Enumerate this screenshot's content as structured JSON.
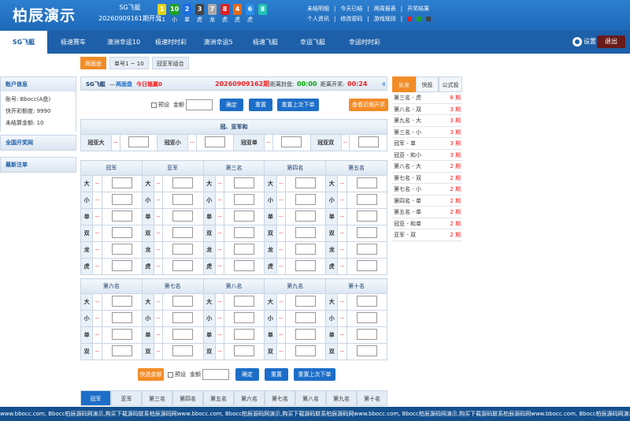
{
  "header": {
    "logo": "柏辰演示",
    "game_name": "SG飞艇",
    "issue": "20260909161期开奖",
    "balls": [
      {
        "n": "1",
        "sub": "11",
        "color": "#e6d51a"
      },
      {
        "n": "10",
        "sub": "小",
        "color": "#1ea31e"
      },
      {
        "n": "2",
        "sub": "单",
        "color": "#1a6ee6"
      },
      {
        "n": "3",
        "sub": "虎",
        "color": "#444"
      },
      {
        "n": "7",
        "sub": "龙",
        "color": "#aaa"
      },
      {
        "n": "8",
        "sub": "虎",
        "color": "#e02020"
      },
      {
        "n": "4",
        "sub": "虎",
        "color": "#e66a1a"
      },
      {
        "n": "6",
        "sub": "虎",
        "color": "#2a8ee6"
      },
      {
        "n": "8",
        "sub": "",
        "color": "#22c3b5"
      }
    ],
    "links_row1": [
      "未结明细",
      "今天已结",
      "两周报表",
      "开奖结果"
    ],
    "links_row2": [
      "个人资讯",
      "修改密码",
      "游戏规则"
    ],
    "swatches": [
      "#e02020",
      "#1ea31e",
      "#444"
    ]
  },
  "nav": {
    "tabs": [
      "SG飞艇",
      "极速赛车",
      "澳洲幸运10",
      "极速时时彩",
      "澳洲幸运5",
      "极速飞艇",
      "幸运飞艇",
      "幸运时时彩"
    ],
    "settings": "设置",
    "exit": "退出"
  },
  "subtabs": [
    "两面盘",
    "单号1 ~ 10",
    "冠亚军组合"
  ],
  "sidebar": {
    "account_title": "账户信息",
    "account_lines": [
      "账号:  Bbocc(A盘)",
      "快开彩额度:  9990",
      "未结算金额:  10"
    ],
    "section2": "全国开奖网",
    "section3": "最新注单"
  },
  "infobar": {
    "game": "SG飞艇",
    "sep": "—",
    "mode": "两面盘",
    "win_label": "今日输赢:",
    "win_value": "0",
    "issue": "20260909162期",
    "close_label": "距离封盘:",
    "close_time": "00:00",
    "open_label": "距离开奖:",
    "open_time": "00:24",
    "num": "4"
  },
  "controls": {
    "preset": "预设",
    "amount": "金额",
    "confirm": "确定",
    "reset": "重置",
    "repeat": "重置上次下单",
    "recent": "查看近期开奖",
    "quick": "快选金额"
  },
  "champion": {
    "title": "冠、亚军和",
    "items": [
      "冠亚大",
      "冠亚小",
      "冠亚单",
      "冠亚双"
    ],
    "odds": "--"
  },
  "table1": {
    "headers": [
      "冠军",
      "亚军",
      "第三名",
      "第四名",
      "第五名"
    ],
    "rows": [
      "大",
      "小",
      "单",
      "双",
      "龙",
      "虎"
    ]
  },
  "table2": {
    "headers": [
      "第六名",
      "第七名",
      "第八名",
      "第九名",
      "第十名"
    ],
    "rows": [
      "大",
      "小",
      "单",
      "双"
    ]
  },
  "right": {
    "tabs": [
      "长龙",
      "快投",
      "公式投"
    ],
    "rows": [
      [
        "第三名 - 虎",
        "8 期"
      ],
      [
        "第八名 - 双",
        "3 期"
      ],
      [
        "第九名 - 大",
        "3 期"
      ],
      [
        "第三名 - 小",
        "3 期"
      ],
      [
        "冠军 - 单",
        "3 期"
      ],
      [
        "冠亚 - 和小",
        "3 期"
      ],
      [
        "第八名 - 大",
        "2 期"
      ],
      [
        "第七名 - 双",
        "2 期"
      ],
      [
        "第七名 - 小",
        "2 期"
      ],
      [
        "第四名 - 单",
        "2 期"
      ],
      [
        "第五名 - 单",
        "2 期"
      ],
      [
        "冠亚 - 和单",
        "2 期"
      ],
      [
        "亚军 - 双",
        "2 期"
      ]
    ]
  },
  "bottom_tabs": [
    "冠军",
    "亚军",
    "第三名",
    "第四名",
    "第五名",
    "第六名",
    "第七名",
    "第八名",
    "第九名",
    "第十名"
  ],
  "marquee": "www.bbocc.com,  Bbocc柏辰源码网演示,购买下载源码联系柏辰源码网www.bbocc.com,  Bbocc柏辰源码网演示,购买下载源码联系柏辰源码网www.bbocc.com,  Bbocc柏辰源码网演示,购买下载源码联系柏辰源码网www.bbocc.com,  Bbocc柏辰源码网演示,购买下载源码联系柏辰源码网"
}
